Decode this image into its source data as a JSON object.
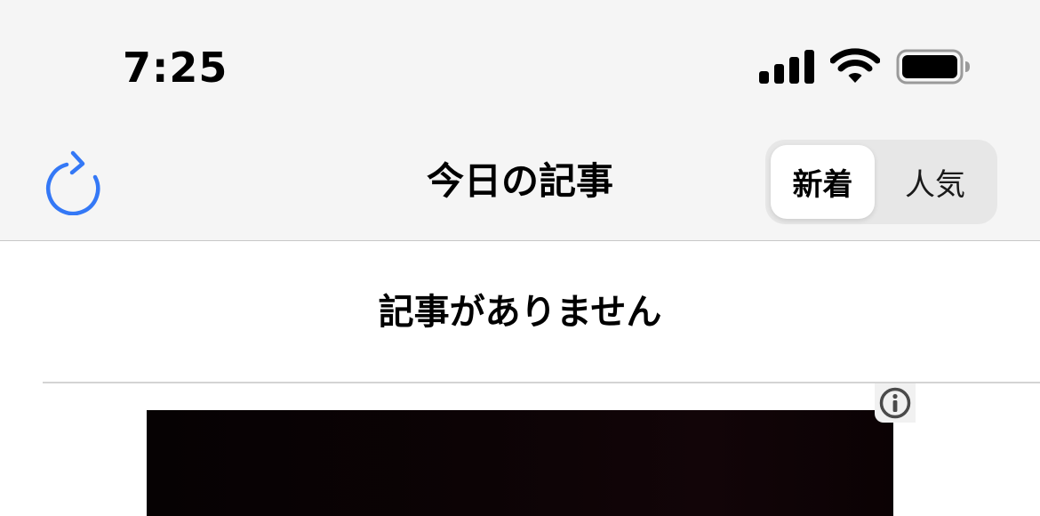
{
  "status_bar": {
    "time": "7:25",
    "icons": [
      "cellular-signal-icon",
      "wifi-icon",
      "battery-icon"
    ]
  },
  "nav_bar": {
    "refresh_icon": "refresh-icon",
    "title": "今日の記事",
    "segments": [
      {
        "label": "新着",
        "selected": true
      },
      {
        "label": "人気",
        "selected": false
      }
    ]
  },
  "content": {
    "empty_message": "記事がありません"
  },
  "ad": {
    "info_icon": "info-icon"
  },
  "colors": {
    "accent": "#3478f6",
    "bar_background": "#f5f5f5",
    "segment_track": "#e7e7e7"
  }
}
